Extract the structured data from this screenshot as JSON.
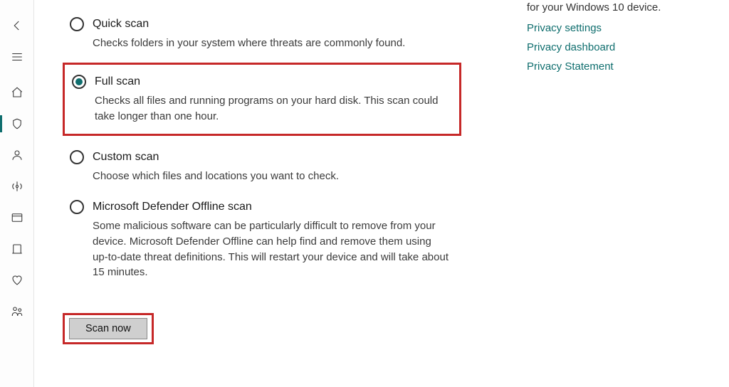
{
  "options": {
    "quick": {
      "label": "Quick scan",
      "desc": "Checks folders in your system where threats are commonly found."
    },
    "full": {
      "label": "Full scan",
      "desc": "Checks all files and running programs on your hard disk. This scan could take longer than one hour."
    },
    "custom": {
      "label": "Custom scan",
      "desc": "Choose which files and locations you want to check."
    },
    "offline": {
      "label": "Microsoft Defender Offline scan",
      "desc": "Some malicious software can be particularly difficult to remove from your device. Microsoft Defender Offline can help find and remove them using up-to-date threat definitions. This will restart your device and will take about 15 minutes."
    }
  },
  "action": {
    "scan_now": "Scan now"
  },
  "right": {
    "desc": "for your Windows 10 device.",
    "links": {
      "settings": "Privacy settings",
      "dashboard": "Privacy dashboard",
      "statement": "Privacy Statement"
    }
  }
}
